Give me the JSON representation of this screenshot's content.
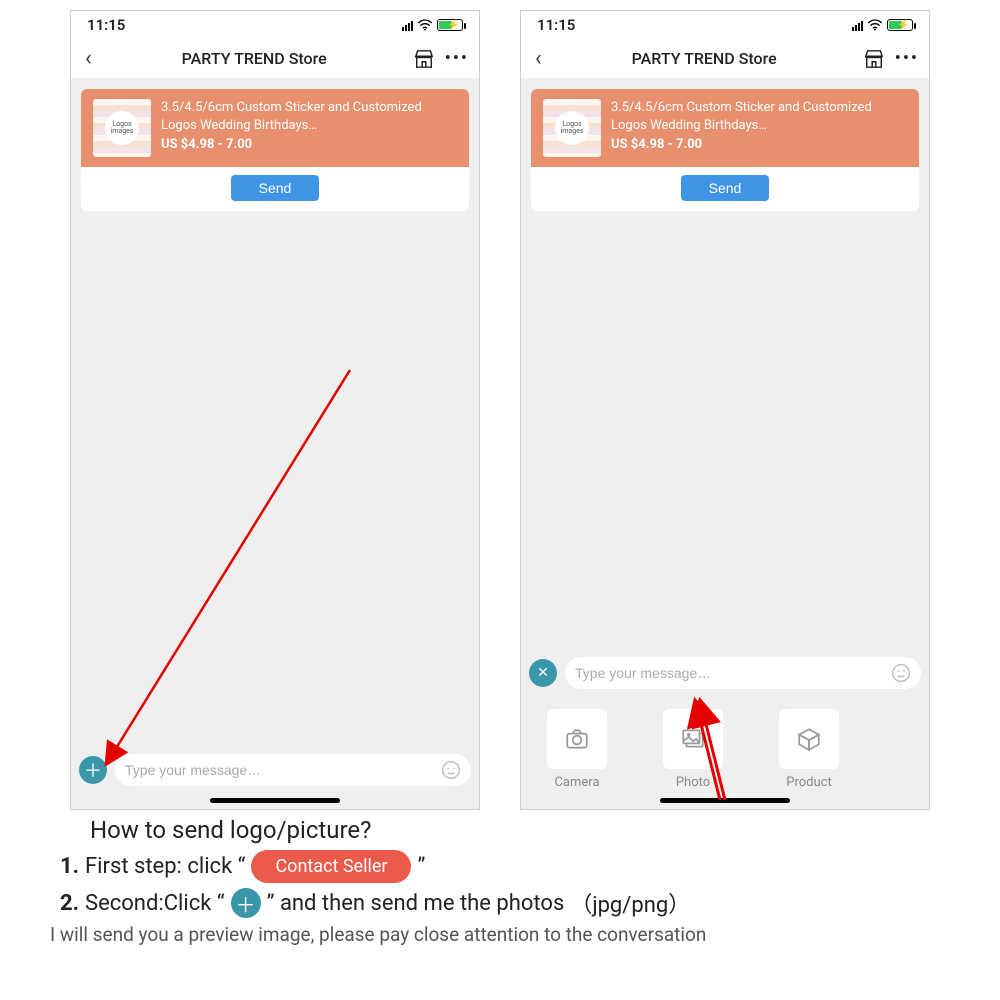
{
  "status": {
    "time": "11:15"
  },
  "nav": {
    "title": "PARTY TREND Store"
  },
  "product": {
    "thumb_line1": "Logos",
    "thumb_line2": "images",
    "title": "3.5/4.5/6cm Custom Sticker and Customized Logos Wedding Birthdays…",
    "price": "US $4.98 - 7.00"
  },
  "buttons": {
    "send": "Send",
    "contact_seller": "Contact Seller"
  },
  "input": {
    "placeholder": "Type your message…"
  },
  "attach": {
    "camera": "Camera",
    "photo": "Photo",
    "product": "Product"
  },
  "instructions": {
    "heading": "How to send logo/picture?",
    "step1_num": "1.",
    "step1_prefix": "First step: click “",
    "step1_suffix": "”",
    "step2_num": "2.",
    "step2_prefix": "Second:Click “",
    "step2_mid": "” and then send me the photos ",
    "step2_filetypes": "（jpg/png）",
    "footer": "I will send you a preview image, please pay close attention to the conversation"
  }
}
